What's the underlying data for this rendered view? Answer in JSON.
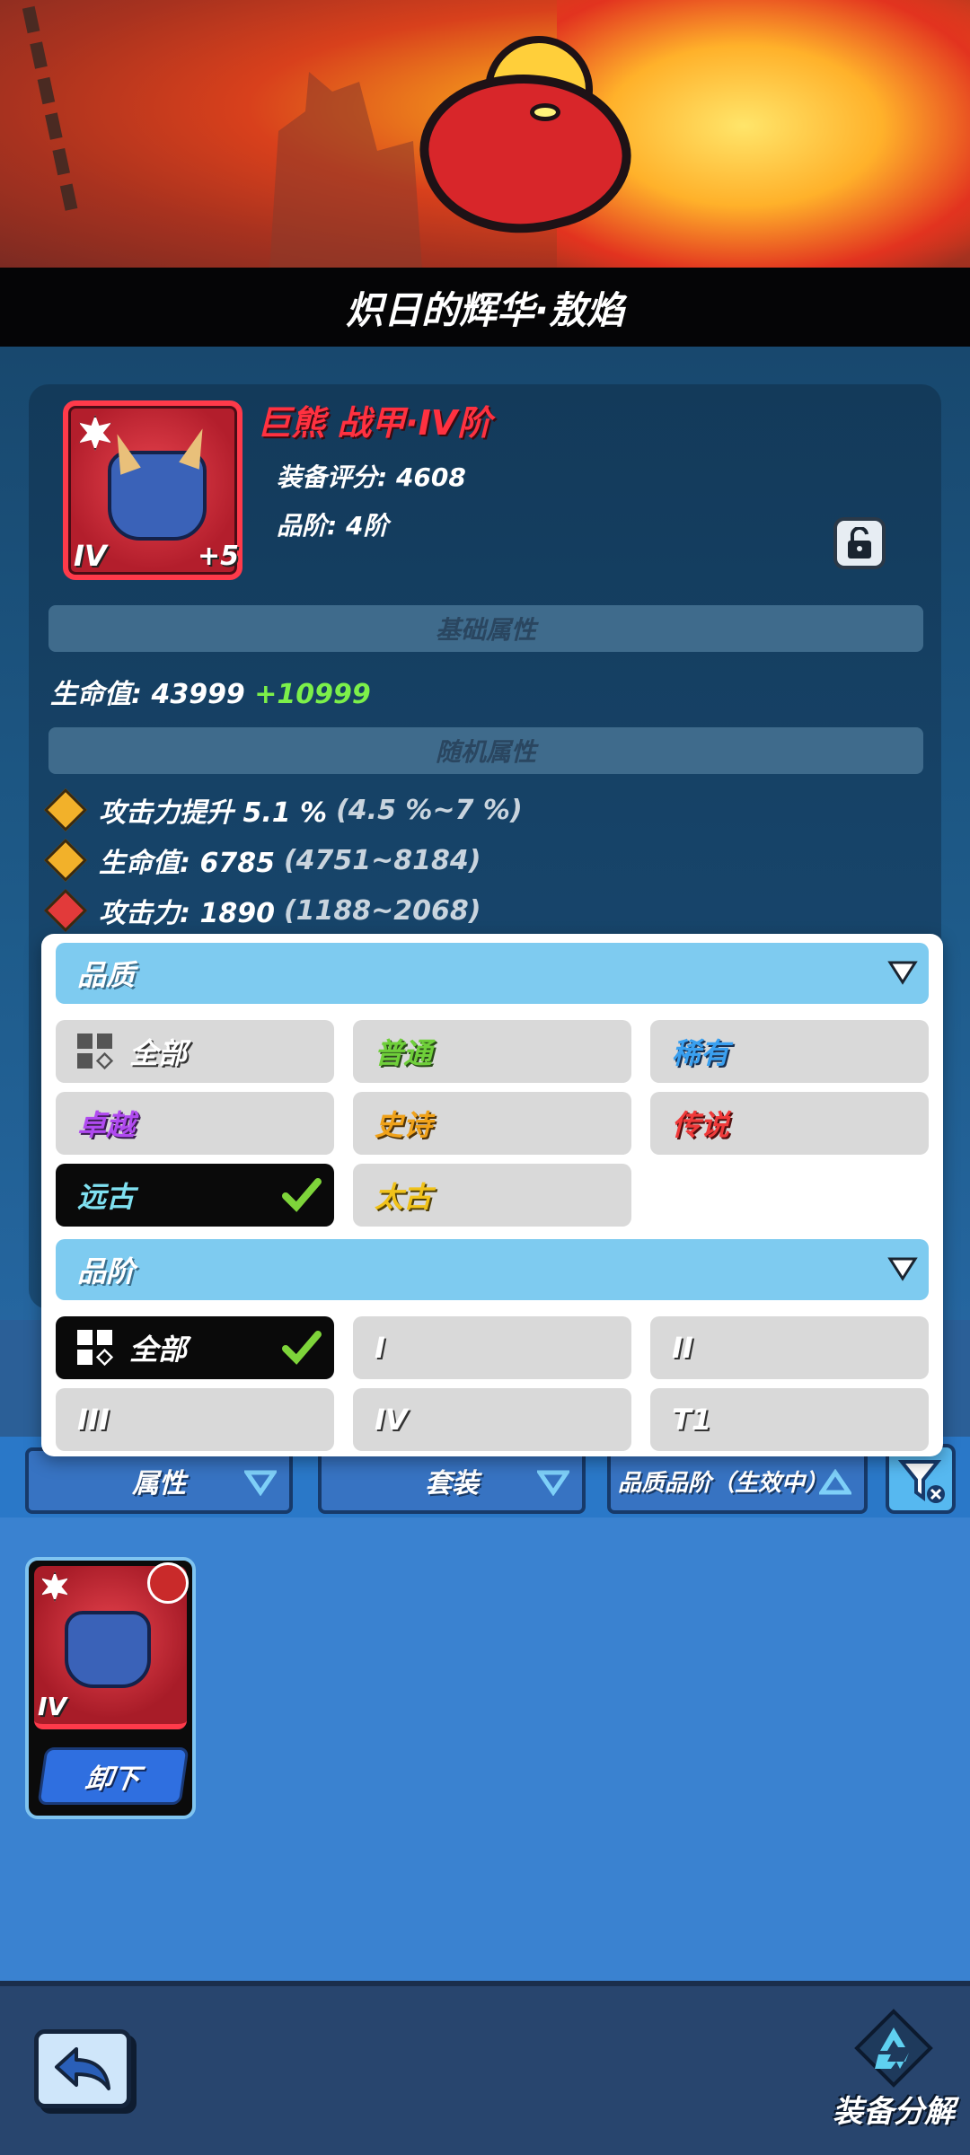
{
  "title": "炽日的辉华·敖焰",
  "item": {
    "name": "巨熊 战甲·IV阶",
    "score": "装备评分: 4608",
    "rank": "品阶: 4阶",
    "tier_tag": "IV",
    "plus_tag": "+5"
  },
  "base_section": {
    "title": "基础属性",
    "hp_label": "生命值: 43999",
    "hp_bonus": "+10999"
  },
  "random_section": {
    "title": "随机属性",
    "attributes": [
      {
        "text": "攻击力提升 5.1 %",
        "range": "(4.5 %~7 %)",
        "gem_color": "#f2b12a"
      },
      {
        "text": "生命值: 6785",
        "range": "(4751~8184)",
        "gem_color": "#f2b12a"
      },
      {
        "text": "攻击力: 1890",
        "range": "(1188~2068)",
        "gem_color": "#e23a3a"
      }
    ]
  },
  "filter": {
    "quality_header": "品质",
    "quality_options": [
      {
        "label": "全部",
        "color": "#ffffff",
        "selected": false
      },
      {
        "label": "普通",
        "color": "#6fcf3a",
        "selected": false
      },
      {
        "label": "稀有",
        "color": "#3aa0f0",
        "selected": false
      },
      {
        "label": "卓越",
        "color": "#b04af0",
        "selected": false
      },
      {
        "label": "史诗",
        "color": "#f0a21a",
        "selected": false
      },
      {
        "label": "传说",
        "color": "#f03a3a",
        "selected": false
      },
      {
        "label": "远古",
        "color": "#7fe0f0",
        "selected": true
      },
      {
        "label": "太古",
        "color": "#f0c21a",
        "selected": false
      }
    ],
    "rank_header": "品阶",
    "rank_options": [
      {
        "label": "全部",
        "selected": true
      },
      {
        "label": "I",
        "selected": false
      },
      {
        "label": "II",
        "selected": false
      },
      {
        "label": "III",
        "selected": false
      },
      {
        "label": "IV",
        "selected": false
      },
      {
        "label": "T1",
        "selected": false
      }
    ]
  },
  "tabs": {
    "attribute": "属性",
    "set": "套装",
    "quality_rank": "品质品阶（生效中）"
  },
  "inventory": {
    "card_tier": "IV",
    "unequip_label": "卸下"
  },
  "bottom": {
    "salvage_label": "装备分解"
  },
  "colors": {
    "accent_blue": "#7ecbf0",
    "check_green": "#7ed43a",
    "item_red": "#ff3140"
  }
}
